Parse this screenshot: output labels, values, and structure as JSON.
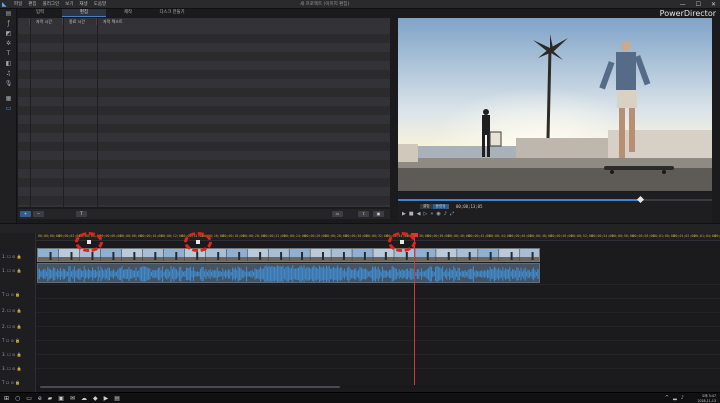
{
  "app": {
    "brand": "PowerDirector",
    "window_title": "새 프로젝트 (이미지 편집)",
    "menu": [
      "파일",
      "편집",
      "플러그인",
      "보기",
      "재생",
      "도움말"
    ],
    "window_controls": [
      "—",
      "☐",
      "✕"
    ]
  },
  "tabs": [
    {
      "label": "입력",
      "active": false
    },
    {
      "label": "편집",
      "active": true
    },
    {
      "label": "제작",
      "active": false
    },
    {
      "label": "디스크 만들기",
      "active": false
    }
  ],
  "subtitle_table": {
    "columns": [
      "자막 시간",
      "종료 시간",
      "자막 텍스트"
    ],
    "row_count": 20
  },
  "preview": {
    "mode_labels": [
      "클립",
      "동영상"
    ],
    "timecode": "00;00;13;05",
    "progress_percent": 77
  },
  "timeline": {
    "ruler_ticks": [
      "00;00;00;00",
      "00;00;02;00",
      "00;00;04;00",
      "00;00;06;00",
      "00;00;08;00",
      "00;00;10;00",
      "00;00;12;00",
      "00;00;14;00",
      "00;00;16;00",
      "00;00;18;00",
      "00;00;20;00",
      "00;00;22;00",
      "00;00;24;00",
      "00;00;26;00",
      "00;00;28;00",
      "00;00;30;00",
      "00;00;32;00",
      "00;00;34;00",
      "00;00;36;00",
      "00;00;38;00",
      "00;00;40;00",
      "00;00;42;00",
      "00;00;44;00",
      "00;00;46;00",
      "00;00;48;00",
      "00;00;50;00",
      "00;00;52;00",
      "00;00;54;00",
      "00;00;56;00",
      "00;00;58;00",
      "00;01;00;00",
      "00;01;02;00",
      "00;01;04;00",
      "00;01;06;00"
    ],
    "tracks": [
      "1.",
      "1.",
      "T",
      "2.",
      "2.",
      "T",
      "3.",
      "3.",
      "T",
      "T",
      "T"
    ]
  },
  "taskbar": {
    "time": "오후 5:47",
    "date": "2018-11-13"
  }
}
